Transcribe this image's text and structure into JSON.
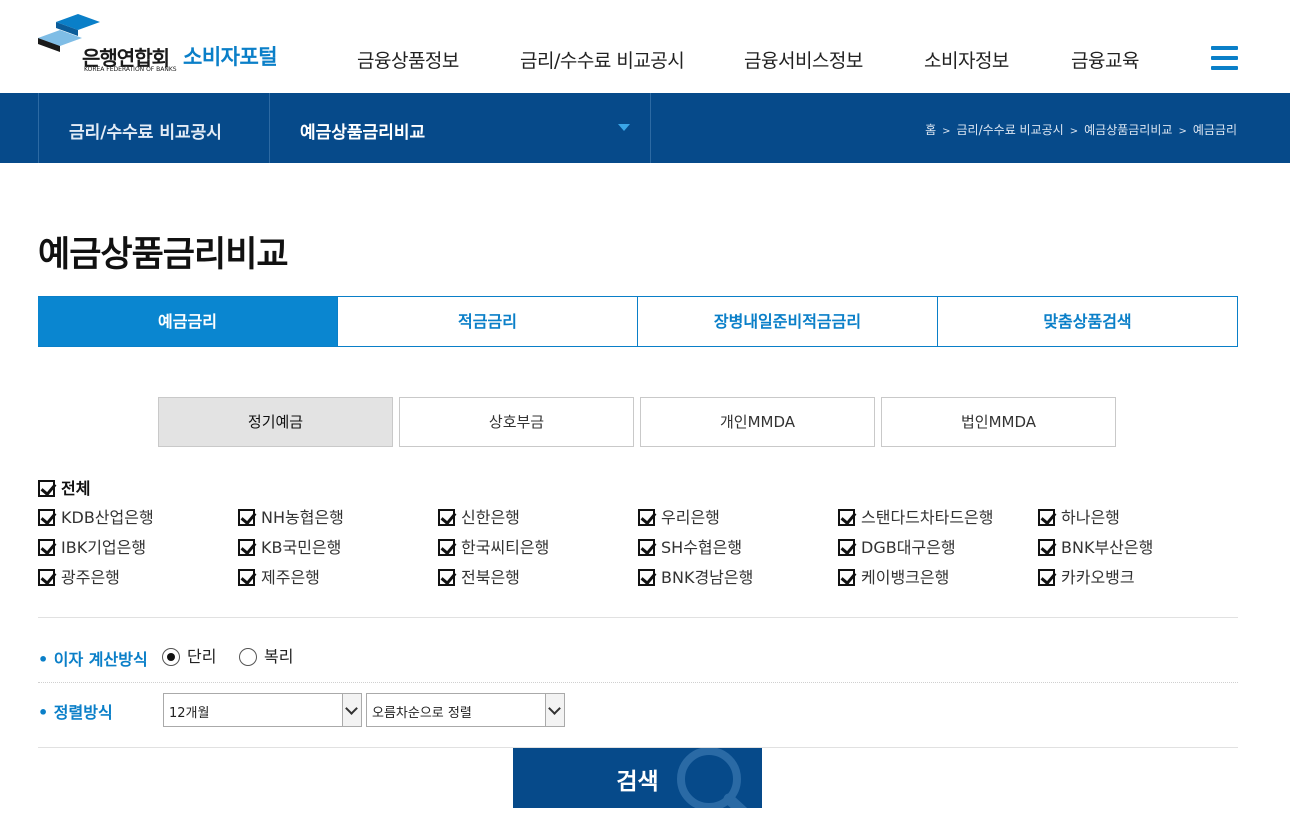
{
  "logo": {
    "name_ko": "은행연합회",
    "name_en": "KOREA FEDERATION OF BANKS",
    "portal": "소비자포털"
  },
  "gnb": [
    {
      "label": "금융상품정보"
    },
    {
      "label": "금리/수수료 비교공시"
    },
    {
      "label": "금융서비스정보"
    },
    {
      "label": "소비자정보"
    },
    {
      "label": "금융교육"
    }
  ],
  "subnav": {
    "level1": "금리/수수료 비교공시",
    "level2": "예금상품금리비교"
  },
  "breadcrumb": [
    "홈",
    "금리/수수료 비교공시",
    "예금상품금리비교",
    "예금금리"
  ],
  "page_title": "예금상품금리비교",
  "tabs": [
    {
      "label": "예금금리",
      "active": true
    },
    {
      "label": "적금금리",
      "active": false
    },
    {
      "label": "장병내일준비적금금리",
      "active": false
    },
    {
      "label": "맞춤상품검색",
      "active": false
    }
  ],
  "subtabs": [
    {
      "label": "정기예금",
      "active": true
    },
    {
      "label": "상호부금",
      "active": false
    },
    {
      "label": "개인MMDA",
      "active": false
    },
    {
      "label": "법인MMDA",
      "active": false
    }
  ],
  "banks": {
    "all_label": "전체",
    "list": [
      "KDB산업은행",
      "NH농협은행",
      "신한은행",
      "우리은행",
      "스탠다드차타드은행",
      "하나은행",
      "IBK기업은행",
      "KB국민은행",
      "한국씨티은행",
      "SH수협은행",
      "DGB대구은행",
      "BNK부산은행",
      "광주은행",
      "제주은행",
      "전북은행",
      "BNK경남은행",
      "케이뱅크은행",
      "카카오뱅크"
    ]
  },
  "interest": {
    "label": "• 이자 계산방식",
    "options": [
      "단리",
      "복리"
    ],
    "selected": "단리"
  },
  "sort": {
    "label": "• 정렬방식",
    "period": "12개월",
    "order": "오름차순으로 정렬"
  },
  "search_button": "검색",
  "colors": {
    "brand_blue": "#0a86d0",
    "navy": "#064a8a"
  }
}
